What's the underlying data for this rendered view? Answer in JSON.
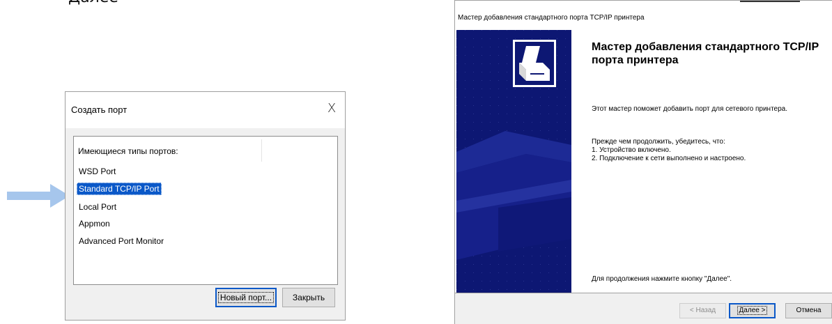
{
  "background_text": "Далее",
  "colors": {
    "accent": "#0a58c8",
    "banner": "#0d1773",
    "arrow": "#a6c6ec"
  },
  "create_port_dialog": {
    "title": "Создать порт",
    "close_glyph": "X",
    "list_header": "Имеющиеся типы портов:",
    "port_types": [
      {
        "label": "WSD Port",
        "selected": false
      },
      {
        "label": "Standard TCP/IP Port",
        "selected": true
      },
      {
        "label": "Local Port",
        "selected": false
      },
      {
        "label": "Appmon",
        "selected": false
      },
      {
        "label": "Advanced Port Monitor",
        "selected": false
      }
    ],
    "new_port_button": "Новый порт...",
    "close_button": "Закрыть"
  },
  "wizard": {
    "window_title": "Мастер добавления стандартного порта TCP/IP принтера",
    "heading": "Мастер добавления стандартного TCP/IP порта принтера",
    "intro": "Этот мастер поможет добавить порт для сетевого принтера.",
    "checklist_intro": "Прежде чем продолжить, убедитесь, что:",
    "checklist": [
      "1.  Устройство включено.",
      "2.  Подключение к сети выполнено и настроено."
    ],
    "continue_hint": "Для продолжения нажмите кнопку \"Далее\".",
    "back_button": "< Назад",
    "next_button": "Далее >",
    "cancel_button": "Отмена"
  }
}
